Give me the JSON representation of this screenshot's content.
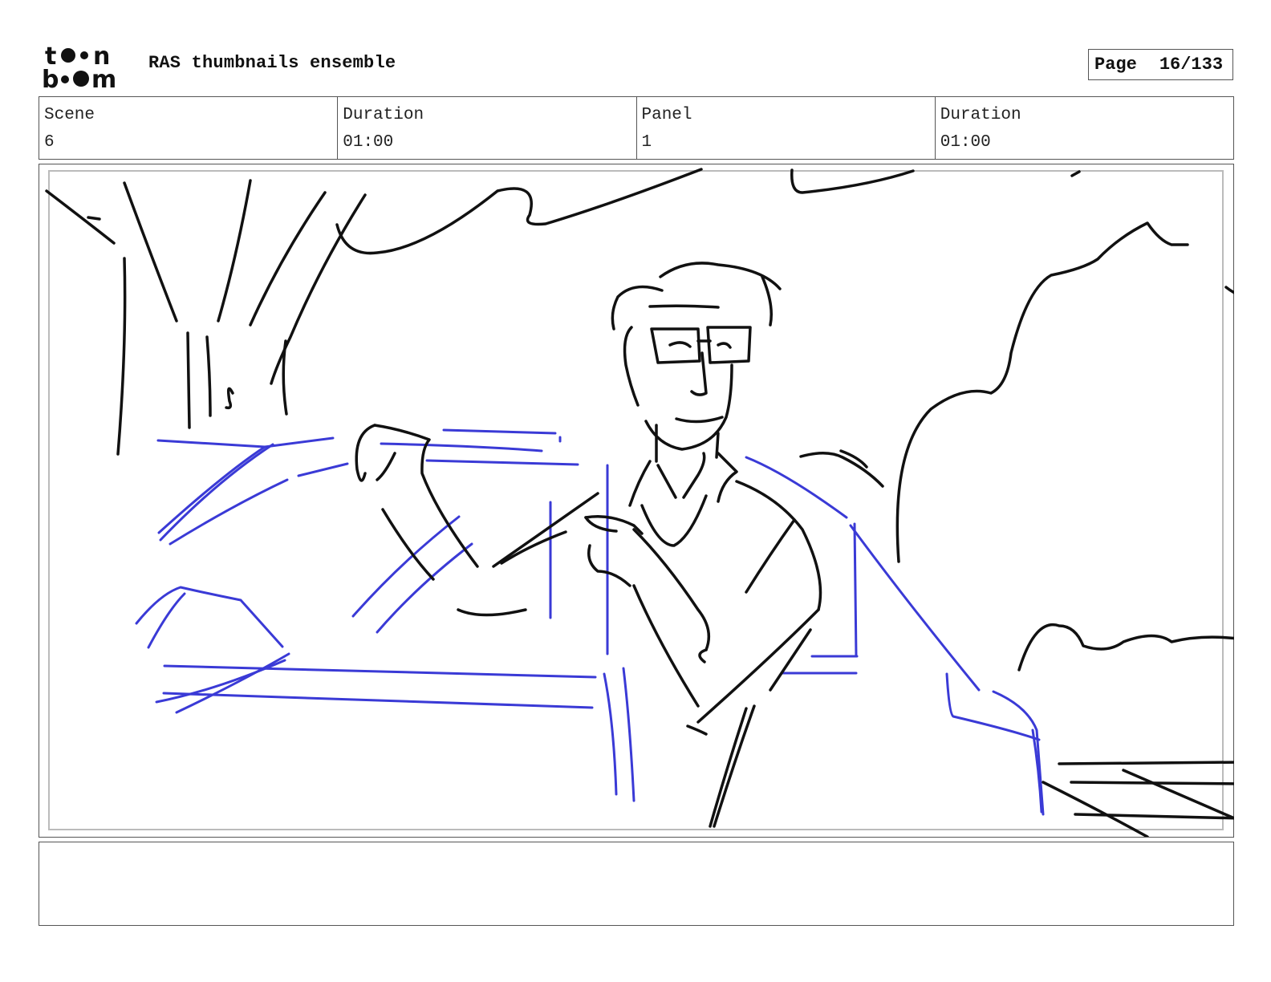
{
  "header": {
    "logo_text": "toon boom",
    "title": "RAS thumbnails ensemble",
    "page_label": "Page",
    "page_number": "16/133"
  },
  "info": {
    "scene_label": "Scene",
    "scene_value": "6",
    "scene_duration_label": "Duration",
    "scene_duration_value": "01:00",
    "panel_label": "Panel",
    "panel_value": "1",
    "panel_duration_label": "Duration",
    "panel_duration_value": "01:00"
  },
  "panel": {
    "ink_color": "#111111",
    "construction_color": "#3a3ad6",
    "frame_color": "#bbbbbb"
  },
  "notes": {
    "text": ""
  }
}
